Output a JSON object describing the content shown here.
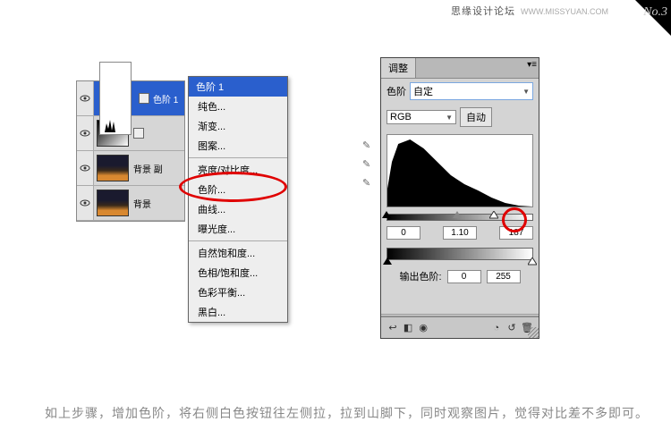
{
  "watermark": {
    "main": "思缘设计论坛",
    "sub": "WWW.MISSYUAN.COM",
    "corner": "No.3"
  },
  "layers": {
    "rows": [
      {
        "name": "色阶 1",
        "type": "hist",
        "sel": true
      },
      {
        "name": "",
        "type": "grad"
      },
      {
        "name": "背景 副",
        "type": "night"
      },
      {
        "name": "背景",
        "type": "night"
      }
    ]
  },
  "ctx": {
    "header": "色阶 1",
    "items": [
      "纯色...",
      "渐变...",
      "图案..."
    ],
    "items2": [
      "亮度/对比度...",
      "色阶...",
      "曲线...",
      "曝光度..."
    ],
    "items3": [
      "自然饱和度...",
      "色相/饱和度...",
      "色彩平衡...",
      "黑白..."
    ]
  },
  "adj": {
    "tab": "调整",
    "presetLabel": "色阶",
    "preset": "自定",
    "channel": "RGB",
    "auto": "自动",
    "in": {
      "black": "0",
      "mid": "1.10",
      "white": "187"
    },
    "outLabel": "输出色阶:",
    "out": {
      "black": "0",
      "white": "255"
    }
  },
  "caption": "如上步骤，增加色阶，将右侧白色按钮往左侧拉，拉到山脚下，同时观察图片，觉得对比差不多即可。"
}
